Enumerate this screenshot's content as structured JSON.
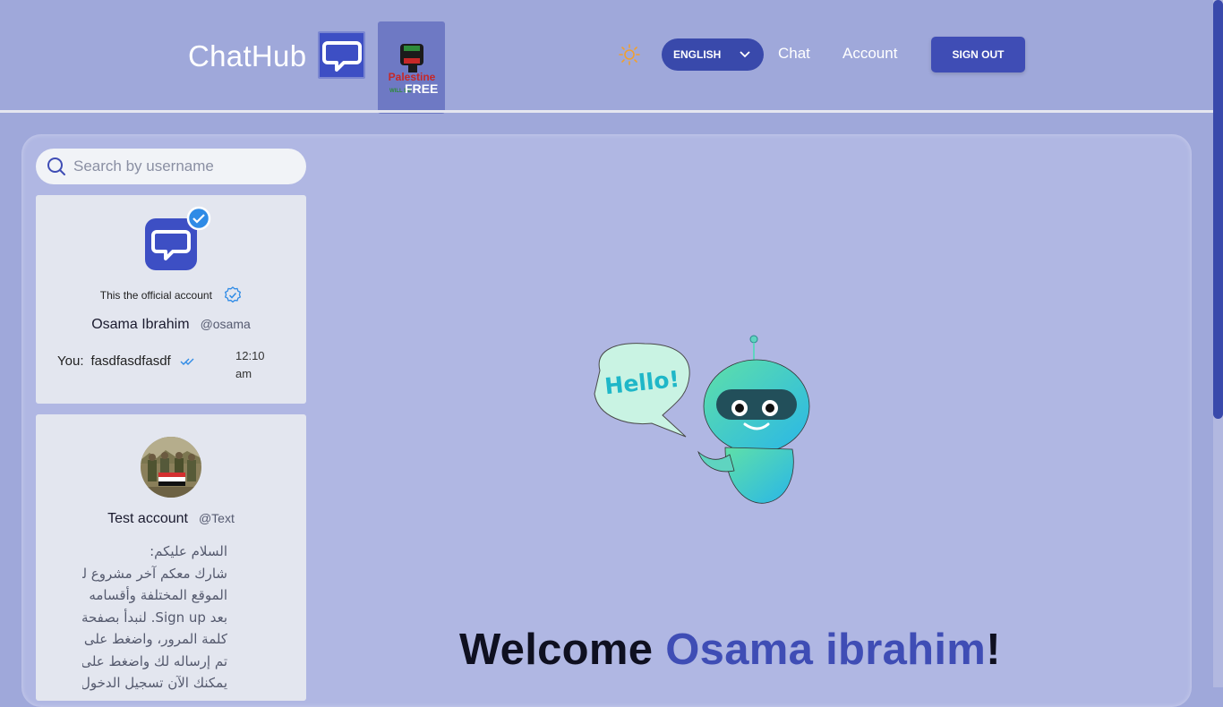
{
  "header": {
    "logo_text": "ChatHub",
    "palestine_text": "Palestine",
    "palestine_sub": "WILL BE",
    "palestine_free": "FREE",
    "language_label": "ENGLISH",
    "nav": {
      "chat": "Chat",
      "account": "Account"
    },
    "sign_out": "SIGN OUT"
  },
  "sidebar": {
    "search_placeholder": "Search by username",
    "chats": [
      {
        "official_label": "This the official account",
        "name": "Osama Ibrahim",
        "username": "@osama",
        "you_label": "You:",
        "last_message": "fasdfasdfasdf",
        "time": "12:10 am"
      },
      {
        "name": "Test account",
        "username": "@Text",
        "message_lines": [
          "السلام عليكم:",
          "شارك معكم آخر مشروع لي",
          "الموقع المختلفة وأقسامه",
          "بعد Sign up. لنبدأ بصفحة",
          "كلمة المرور، واضغط على",
          "تم إرساله لك واضغط على",
          "يمكنك الآن تسجيل الدخول"
        ]
      }
    ]
  },
  "main": {
    "hello_bubble": "Hello!",
    "welcome_prefix": "Welcome ",
    "welcome_name": "Osama ibrahim",
    "welcome_suffix": "!"
  },
  "colors": {
    "accent": "#3f4db5",
    "background": "#9fa8da",
    "panel": "#b0b7e3",
    "card": "#e3e6ef"
  }
}
